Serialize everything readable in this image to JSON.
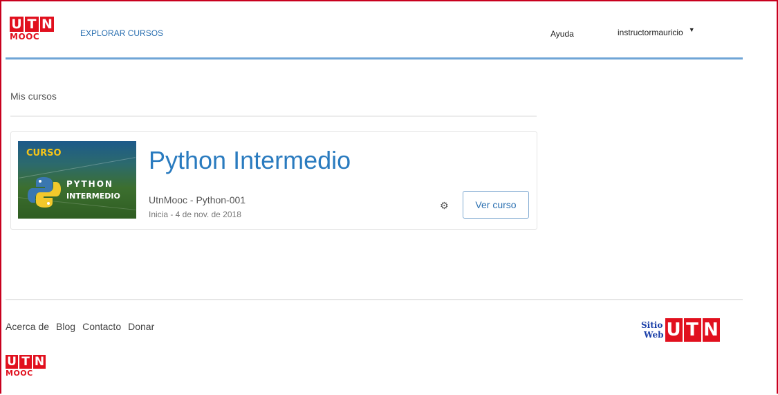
{
  "header": {
    "logo": {
      "mark": [
        "U",
        "T",
        "N"
      ],
      "subtitle": "MOOC"
    },
    "explore_label": "EXPLORAR CURSOS",
    "help_label": "Ayuda",
    "user_label": "instructormauricio",
    "user_caret": "▼"
  },
  "main": {
    "section_title": "Mis cursos",
    "courses": [
      {
        "title": "Python Intermedio",
        "org_code": "UtnMooc - Python-001",
        "start": "Inicia - 4 de nov. de 2018",
        "thumb": {
          "badge": "CURSO",
          "line1": "PYTHON",
          "line2": "INTERMEDIO"
        },
        "settings_icon": "gear-icon",
        "view_label": "Ver curso"
      }
    ]
  },
  "footer": {
    "links": [
      "Acerca de",
      "Blog",
      "Contacto",
      "Donar"
    ],
    "logo": {
      "mark": [
        "U",
        "T",
        "N"
      ],
      "subtitle": "MOOC"
    },
    "site_link": {
      "line1": "Sitio",
      "line2": "Web",
      "mark": [
        "U",
        "T",
        "N"
      ]
    }
  },
  "colors": {
    "brand_red": "#e1101e",
    "link_blue": "#2a7bbf",
    "header_rule": "#6fa5d6"
  }
}
